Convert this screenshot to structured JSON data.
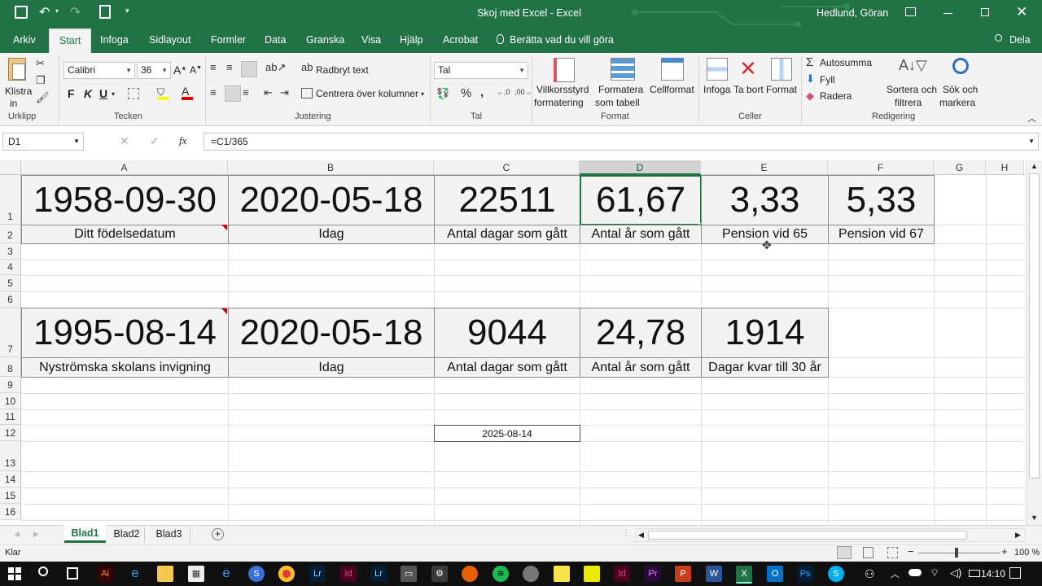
{
  "window": {
    "title": "Skoj med Excel  -  Excel",
    "user": "Hedlund, Göran"
  },
  "qat": {
    "save_icon": "save-icon",
    "undo_icon": "undo-icon",
    "redo_icon": "redo-icon",
    "preview_icon": "print-preview-icon"
  },
  "tabs": [
    "Arkiv",
    "Start",
    "Infoga",
    "Sidlayout",
    "Formler",
    "Data",
    "Granska",
    "Visa",
    "Hjälp",
    "Acrobat",
    "Berätta vad du vill göra"
  ],
  "share_label": "Dela",
  "ribbon": {
    "clipboard": {
      "paste": "Klistra",
      "paste2": "in",
      "group": "Urklipp"
    },
    "font": {
      "name": "Calibri",
      "size": "36",
      "bold": "F",
      "italic": "K",
      "underline": "U",
      "group": "Tecken"
    },
    "alignment": {
      "wrap": "Radbryt text",
      "merge": "Centrera över kolumner",
      "group": "Justering"
    },
    "number": {
      "format": "Tal",
      "group": "Tal"
    },
    "styles": {
      "conditional": "Villkorsstyrd",
      "conditional2": "formatering",
      "table": "Formatera",
      "table2": "som tabell",
      "cellstyles": "Cellformat",
      "group": "Format"
    },
    "cells": {
      "insert": "Infoga",
      "delete": "Ta bort",
      "format": "Format",
      "group": "Celler"
    },
    "editing": {
      "autosum": "Autosumma",
      "fill": "Fyll",
      "clear": "Radera",
      "sort": "Sortera och",
      "sort2": "filtrera",
      "find": "Sök och",
      "find2": "markera",
      "group": "Redigering"
    }
  },
  "formula_bar": {
    "name_box": "D1",
    "formula": "=C1/365"
  },
  "columns": [
    "A",
    "B",
    "C",
    "D",
    "E",
    "F",
    "G",
    "H"
  ],
  "rows": [
    "1",
    "2",
    "3",
    "4",
    "5",
    "6",
    "7",
    "8",
    "9",
    "10",
    "11",
    "12",
    "13",
    "14",
    "15",
    "16"
  ],
  "cells": {
    "A1": "1958-09-30",
    "B1": "2020-05-18",
    "C1": "22511",
    "D1": "61,67",
    "E1": "3,33",
    "F1": "5,33",
    "A2": "Ditt  födelsedatum",
    "B2": "Idag",
    "C2": "Antal dagar som gått",
    "D2": "Antal år som gått",
    "E2": "Pension vid 65",
    "F2": "Pension vid 67",
    "A7": "1995-08-14",
    "B7": "2020-05-18",
    "C7": "9044",
    "D7": "24,78",
    "E7": "1914",
    "A8": "Nyströmska skolans invigning",
    "B8": "Idag",
    "C8": "Antal dagar som gått",
    "D8": "Antal år som gått",
    "E8": "Dagar kvar till 30 år",
    "C12": "2025-08-14"
  },
  "sheets": [
    "Blad1",
    "Blad2",
    "Blad3"
  ],
  "status": {
    "ready": "Klar",
    "zoom": "100 %"
  },
  "taskbar": {
    "time": "14:10"
  }
}
